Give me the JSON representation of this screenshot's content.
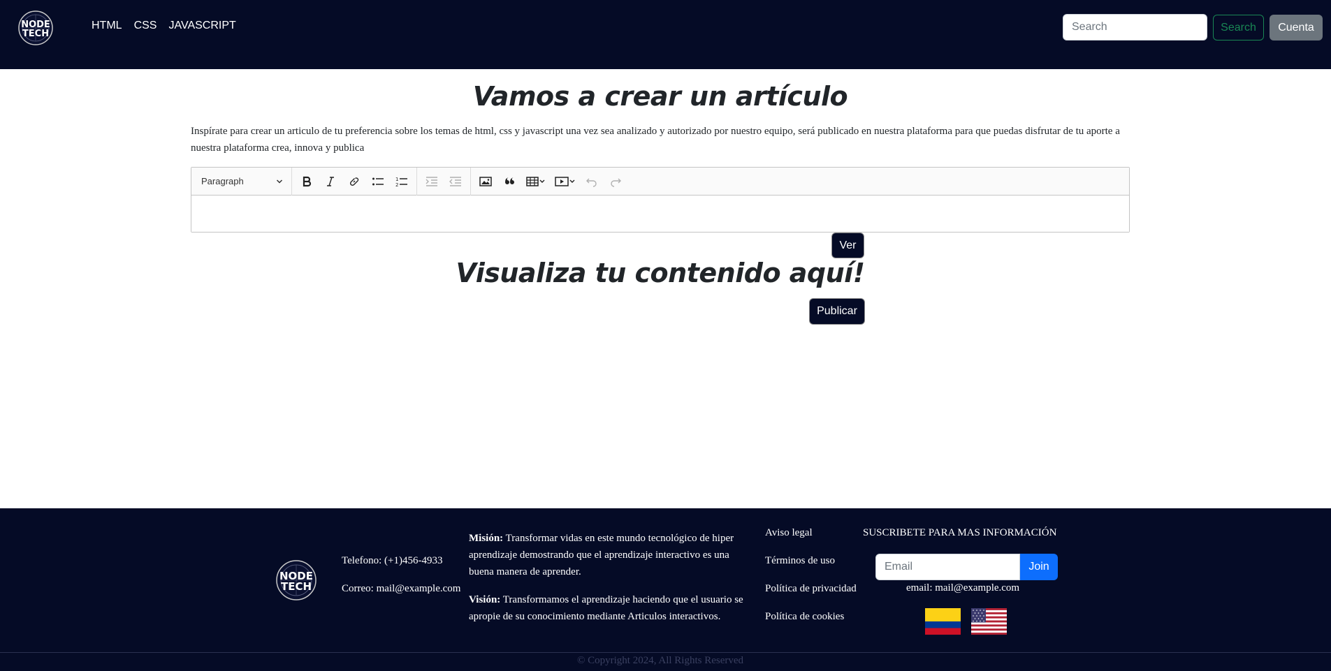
{
  "navbar": {
    "logo_text": "NODE TECH",
    "links": [
      "HTML",
      "CSS",
      "JAVASCRIPT"
    ],
    "search_placeholder": "Search",
    "search_button": "Search",
    "account_button": "Cuenta"
  },
  "main": {
    "title": "Vamos a crear un artículo",
    "intro": "Inspírate para crear un articulo de tu preferencia sobre los temas de html, css y javascript una vez sea analizado y autorizado por nuestro equipo, será publicado en nuestra plataforma para que puedas disfrutar de tu aporte a nuestra plataforma crea, innova y publica",
    "editor": {
      "heading_dropdown": "Paragraph",
      "toolbar_icons": [
        "bold-icon",
        "italic-icon",
        "link-icon",
        "bulleted-list-icon",
        "numbered-list-icon",
        "indent-icon",
        "outdent-icon",
        "image-icon",
        "blockquote-icon",
        "table-icon",
        "media-icon",
        "undo-icon",
        "redo-icon"
      ],
      "content": ""
    },
    "ver_button": "Ver",
    "preview_title": "Visualiza tu contenido aquí!",
    "publish_button": "Publicar"
  },
  "footer": {
    "logo_text": "NODE TECH",
    "phone": "Telefono: (+1)456-4933",
    "email_contact": "Correo: mail@example.com",
    "mission_label": "Misión:",
    "mission_text": " Transformar vidas en este mundo tecnológico de hiper aprendizaje demostrando que el aprendizaje interactivo es una buena manera de aprender.",
    "vision_label": "Visión:",
    "vision_text": " Transformamos el aprendizaje haciendo que el usuario se apropie de su conocimiento mediante Articulos interactivos.",
    "links": [
      "Aviso legal",
      "Términos de uso",
      "Política de privacidad",
      "Política de cookies"
    ],
    "subscribe_title": "SUSCRIBETE PARA MAS INFORMACIÓN",
    "email_placeholder": "Email",
    "join_button": "Join",
    "email_text": "email: mail@example.com",
    "copyright": "© Copyright 2024, All Rights Reserved"
  },
  "colors": {
    "navy": "#050b26",
    "success": "#198754",
    "secondary": "#6c757d",
    "primary": "#0d6efd"
  }
}
